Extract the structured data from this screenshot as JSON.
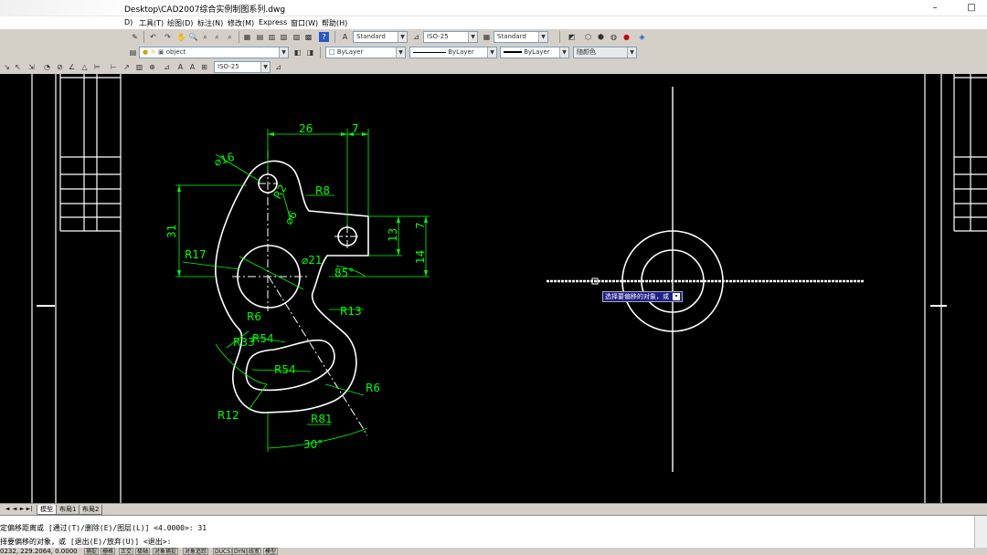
{
  "window": {
    "title": "Desktop\\CAD2007综合实例制图系列.dwg",
    "minimize_glyph": "–",
    "maximize_glyph": "□"
  },
  "menu": {
    "items": [
      "D)",
      "工具(T)",
      "绘图(D)",
      "标注(N)",
      "修改(M)",
      "Express",
      "窗口(W)",
      "帮助(H)"
    ]
  },
  "toolbar": {
    "text_style": "Standard",
    "dim_style": "ISO-25",
    "table_style": "Standard",
    "layer": "object",
    "color": "ByLayer",
    "linetype": "ByLayer",
    "lineweight": "ByLayer",
    "plot_style": "随颜色",
    "dim_style2": "ISO-25",
    "colors": {
      "accent": "#1f1f8a",
      "canvas": "#000000",
      "dim_green": "#00ff00"
    }
  },
  "drawing": {
    "dimensions": [
      "26",
      "7",
      "⌀16",
      "R8",
      "R2",
      "⌀6",
      "31",
      "13",
      "7",
      "14",
      "R17",
      "⌀21",
      "85°",
      "R13",
      "R6",
      "R33",
      "R54",
      "R54",
      "R6",
      "R12",
      "R81",
      "30°"
    ]
  },
  "tooltip": {
    "text": "选择要偏移的对象，或"
  },
  "tabs": {
    "items": [
      "模型",
      "布局1",
      "布局2"
    ],
    "active_index": 0,
    "nav": [
      "◄",
      "◄",
      "►",
      "►|"
    ]
  },
  "command": {
    "line1": "定偏移距离或 [通过(T)/删除(E)/图层(L)] <4.0000>:  31",
    "line2": "择要偏移的对象，或 [退出(E)/放弃(U)] <退出>:"
  },
  "status": {
    "coords": "0232, 229.2064, 0.0000",
    "buttons": [
      "捕捉",
      "栅格",
      "正交",
      "极轴",
      "对象捕捉",
      "对象追踪",
      "DUCS",
      "DYN",
      "线宽",
      "模型"
    ]
  }
}
